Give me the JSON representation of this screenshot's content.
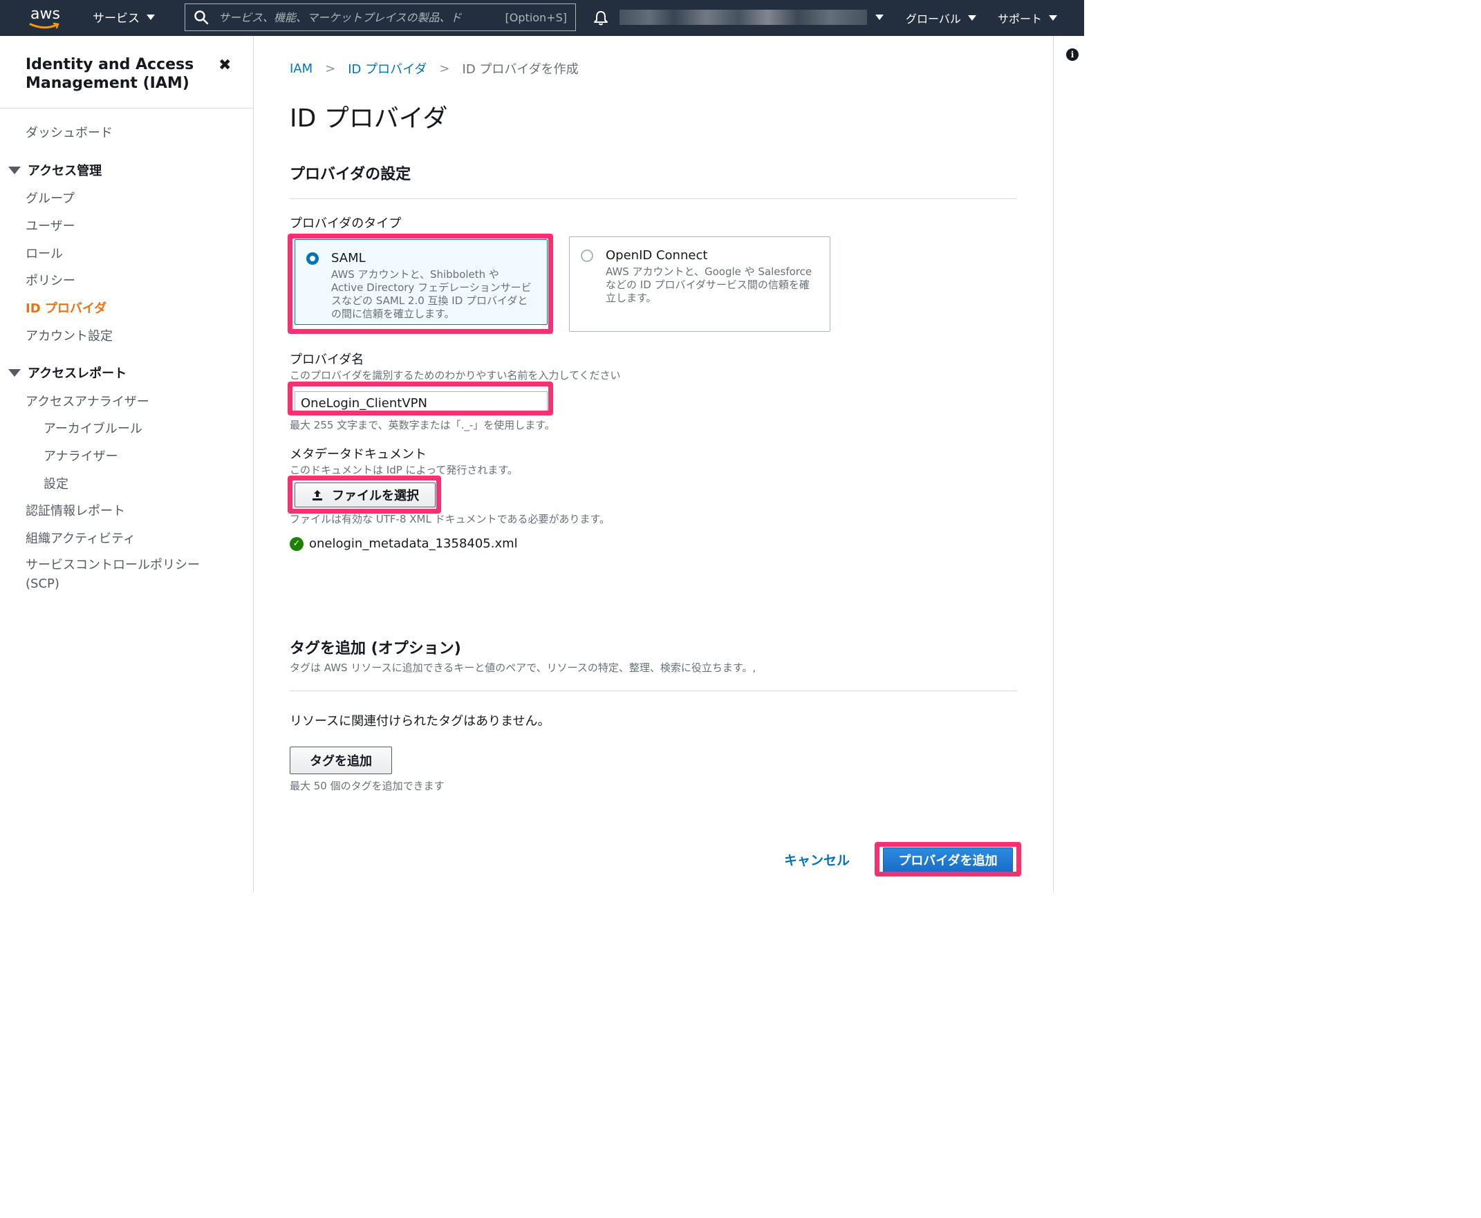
{
  "topnav": {
    "logo_text": "aws",
    "services_label": "サービス",
    "search_placeholder": "サービス、機能、マーケットプレイスの製品、ド",
    "search_shortcut": "[Option+S]",
    "region_label": "グローバル",
    "support_label": "サポート"
  },
  "sidebar": {
    "title": "Identity and Access Management (IAM)",
    "dashboard": "ダッシュボード",
    "access_mgmt": {
      "label": "アクセス管理",
      "items": [
        "グループ",
        "ユーザー",
        "ロール",
        "ポリシー",
        "ID プロバイダ",
        "アカウント設定"
      ]
    },
    "access_report": {
      "label": "アクセスレポート",
      "items": [
        "アクセスアナライザー",
        "アーカイブルール",
        "アナライザー",
        "設定",
        "認証情報レポート",
        "組織アクティビティ",
        "サービスコントロールポリシー (SCP)"
      ]
    }
  },
  "breadcrumb": {
    "items": [
      "IAM",
      "ID プロバイダ",
      "ID プロバイダを作成"
    ]
  },
  "page": {
    "title": "ID プロバイダ",
    "provider_settings_title": "プロバイダの設定",
    "provider_type_label": "プロバイダのタイプ",
    "saml": {
      "title": "SAML",
      "description": "AWS アカウントと、Shibboleth や Active Directory フェデレーションサービスなどの SAML 2.0 互換 ID プロバイダとの間に信頼を確立します。"
    },
    "oidc": {
      "title": "OpenID Connect",
      "description": "AWS アカウントと、Google や Salesforce などの ID プロバイダサービス間の信頼を確立します。"
    },
    "provider_name_label": "プロバイダ名",
    "provider_name_desc": "このプロバイダを識別するためのわかりやすい名前を入力してください",
    "provider_name_value": "OneLogin_ClientVPN",
    "provider_name_hint": "最大 255 文字まで、英数字または「._-」を使用します。",
    "metadata_label": "メタデータドキュメント",
    "metadata_desc": "このドキュメントは IdP によって発行されます。",
    "choose_file_label": "ファイルを選択",
    "file_hint": "ファイルは有効な UTF-8 XML ドキュメントである必要があります。",
    "file_name": "onelogin_metadata_1358405.xml",
    "tags_title": "タグを追加 (オプション)",
    "tags_desc": "タグは AWS リソースに追加できるキーと値のペアで、リソースの特定、整理、検索に役立ちます。,",
    "no_tags": "リソースに関連付けられたタグはありません。",
    "add_tag_label": "タグを追加",
    "tag_limit": "最大 50 個のタグを追加できます",
    "cancel_label": "キャンセル",
    "submit_label": "プロバイダを追加"
  },
  "colors": {
    "nav_bg": "#232f3e",
    "link": "#0073bb",
    "active_nav": "#ec7211",
    "highlight": "#f53170",
    "success": "#1d8102"
  }
}
